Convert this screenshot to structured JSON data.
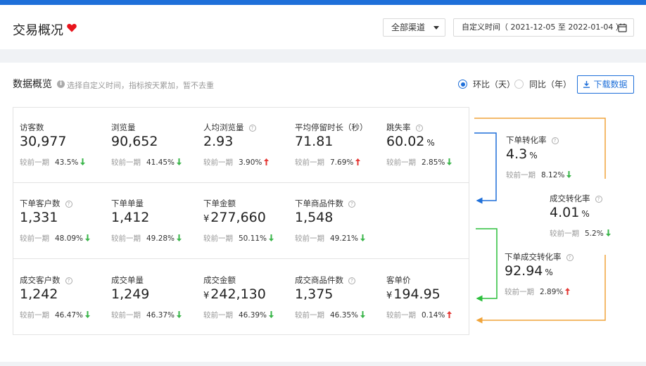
{
  "header": {
    "title": "交易概况",
    "channel_select": "全部渠道",
    "date_range": "自定义时间（ 2021-12-05 至 2022-01-04 ）"
  },
  "overview": {
    "title": "数据概览",
    "hint": "选择自定义时间，指标按天累加，暂不去重",
    "radio_mom": "环比（天）",
    "radio_yoy": "同比（年）",
    "radio_selected": "环比（天）",
    "download": "下载数据",
    "compare_label": "较前一期"
  },
  "colors": {
    "up": "#e53935",
    "down": "#3ab54a",
    "accent": "#1e6fd9",
    "orange": "#f0a43a",
    "green": "#2bbf3c"
  },
  "metrics": {
    "visitors": {
      "label": "访客数",
      "value": "30,977",
      "change": "43.5%",
      "trend": "down"
    },
    "pageviews": {
      "label": "浏览量",
      "value": "90,652",
      "change": "41.45%",
      "trend": "down"
    },
    "avg_pv": {
      "label": "人均浏览量",
      "value": "2.93",
      "change": "3.90%",
      "trend": "up"
    },
    "avg_stay": {
      "label": "平均停留时长（秒）",
      "value": "71.81",
      "change": "7.69%",
      "trend": "up"
    },
    "bounce": {
      "label": "跳失率",
      "value": "60.02",
      "unit": "%",
      "change": "2.85%",
      "trend": "down"
    },
    "order_customers": {
      "label": "下单客户数",
      "value": "1,331",
      "change": "48.09%",
      "trend": "down"
    },
    "order_count": {
      "label": "下单单量",
      "value": "1,412",
      "change": "49.28%",
      "trend": "down"
    },
    "order_amount": {
      "label": "下单金额",
      "prefix": "¥",
      "value": "277,660",
      "change": "50.11%",
      "trend": "down"
    },
    "order_items": {
      "label": "下单商品件数",
      "value": "1,548",
      "change": "49.21%",
      "trend": "down"
    },
    "deal_customers": {
      "label": "成交客户数",
      "value": "1,242",
      "change": "46.47%",
      "trend": "down"
    },
    "deal_count": {
      "label": "成交单量",
      "value": "1,249",
      "change": "46.37%",
      "trend": "down"
    },
    "deal_amount": {
      "label": "成交金额",
      "prefix": "¥",
      "value": "242,130",
      "change": "46.39%",
      "trend": "down"
    },
    "deal_items": {
      "label": "成交商品件数",
      "value": "1,375",
      "change": "46.35%",
      "trend": "down"
    },
    "unit_price": {
      "label": "客单价",
      "prefix": "¥",
      "value": "194.95",
      "change": "0.14%",
      "trend": "up"
    },
    "order_conv": {
      "label": "下单转化率",
      "value": "4.3",
      "unit": "%",
      "change": "8.12%",
      "trend": "down"
    },
    "deal_conv": {
      "label": "成交转化率",
      "value": "4.01",
      "unit": "%",
      "change": "5.2%",
      "trend": "down"
    },
    "order_deal_conv": {
      "label": "下单成交转化率",
      "value": "92.94",
      "unit": "%",
      "change": "2.89%",
      "trend": "up"
    }
  }
}
